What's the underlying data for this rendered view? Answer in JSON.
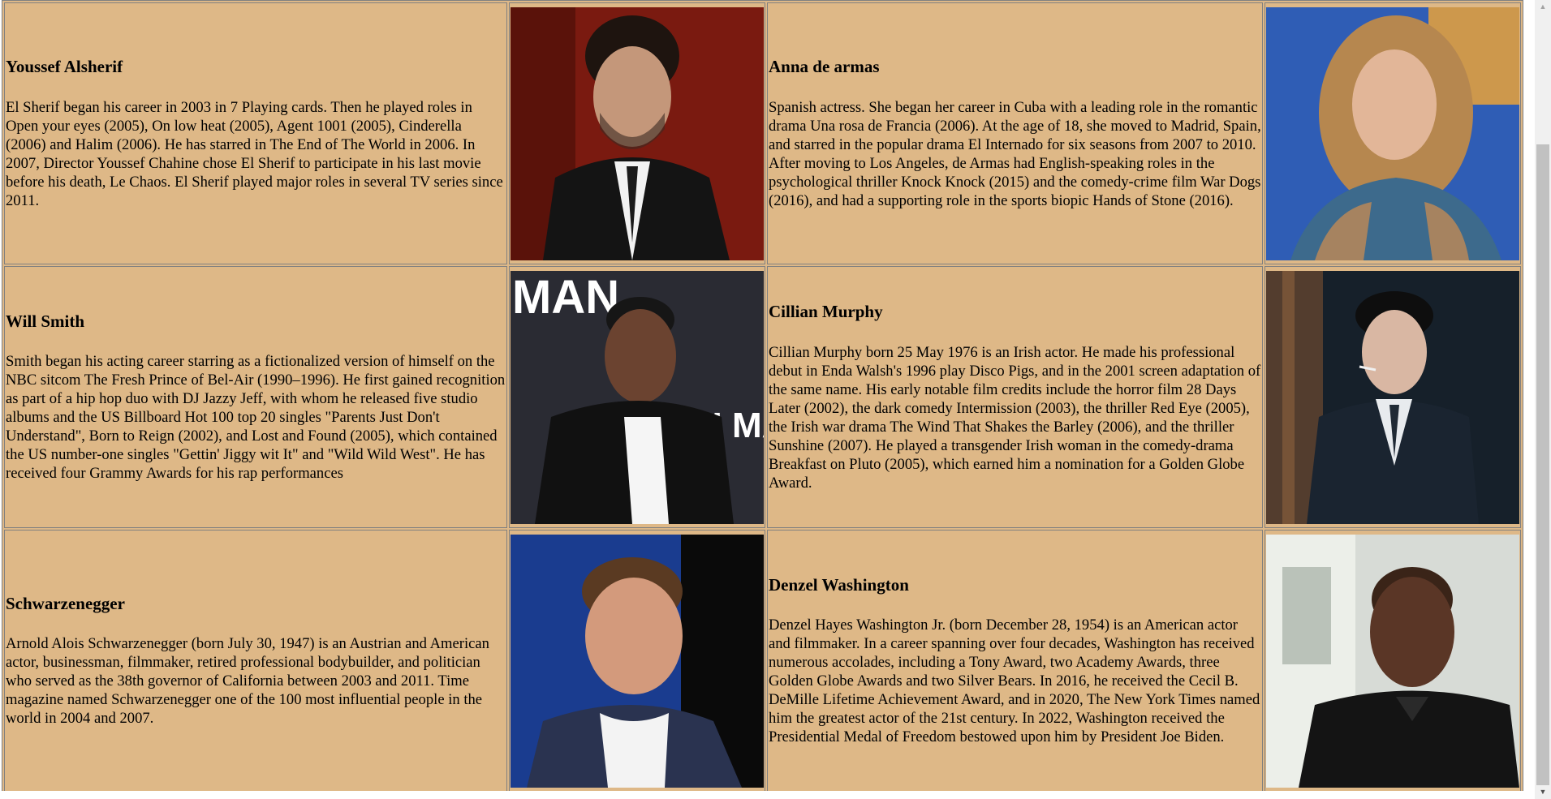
{
  "actors": [
    {
      "name": "Youssef Alsherif",
      "bio": "El Sherif began his career in 2003 in 7 Playing cards. Then he played roles in Open your eyes (2005), On low heat (2005), Agent 1001 (2005), Cinderella (2006) and Halim (2006). He has starred in The End of The World in 2006. In 2007, Director Youssef Chahine chose El Sherif to participate in his last movie before his death, Le Chaos. El Sherif played major roles in several TV series since 2011.",
      "photo_palette": {
        "bg": "#8a1c10",
        "skin": "#c79a7c",
        "suit": "#151515",
        "hair": "#201510"
      }
    },
    {
      "name": "Anna de armas",
      "bio": "Spanish actress. She began her career in Cuba with a leading role in the romantic drama Una rosa de Francia (2006). At the age of 18, she moved to Madrid, Spain, and starred in the popular drama El Internado for six seasons from 2007 to 2010. After moving to Los Angeles, de Armas had English-speaking roles in the psychological thriller Knock Knock (2015) and the comedy-crime film War Dogs (2016), and had a supporting role in the sports biopic Hands of Stone (2016).",
      "photo_palette": {
        "bg": "#2f5db5",
        "skin": "#e0b396",
        "suit": "#3c6a8a",
        "hair": "#b88a52"
      }
    },
    {
      "name": "Will Smith",
      "bio": "Smith began his acting career starring as a fictionalized version of himself on the NBC sitcom The Fresh Prince of Bel-Air (1990–1996). He first gained recognition as part of a hip hop duo with DJ Jazzy Jeff, with whom he released five studio albums and the US Billboard Hot 100 top 20 singles \"Parents Just Don't Understand\", Born to Reign (2002), and Lost and Found (2005), which contained the US number-one singles \"Gettin' Jiggy wit It\" and \"Wild Wild West\". He has received four Grammy Awards for his rap performances",
      "photo_palette": {
        "bg": "#2a2b33",
        "skin": "#6b4330",
        "suit": "#111111",
        "hair": "#1a1a1a"
      },
      "backdrop_text": [
        "MAN",
        "ANI MAN"
      ]
    },
    {
      "name": "Cillian Murphy",
      "bio": "Cillian Murphy born 25 May 1976 is an Irish actor. He made his professional debut in Enda Walsh's 1996 play Disco Pigs, and in the 2001 screen adaptation of the same name. His early notable film credits include the horror film 28 Days Later (2002), the dark comedy Intermission (2003), the thriller Red Eye (2005), the Irish war drama The Wind That Shakes the Barley (2006), and the thriller Sunshine (2007). He played a transgender Irish woman in the comedy-drama Breakfast on Pluto (2005), which earned him a nomination for a Golden Globe Award.",
      "photo_palette": {
        "bg": "#1b2630",
        "skin": "#d9b7a3",
        "suit": "#17202a",
        "hair": "#0e0e0e"
      }
    },
    {
      "name": "Schwarzenegger",
      "bio": "Arnold Alois Schwarzenegger (born July 30, 1947) is an Austrian and American actor, businessman, filmmaker, retired professional bodybuilder, and politician who served as the 38th governor of California between 2003 and 2011. Time magazine named Schwarzenegger one of the 100 most influential people in the world in 2004 and 2007.",
      "photo_palette": {
        "bg": "#1a3c8f",
        "skin": "#d39a7c",
        "suit": "#2a3350",
        "hair": "#5a3a22"
      }
    },
    {
      "name": "Denzel Washington",
      "bio": "Denzel Hayes Washington Jr. (born December 28, 1954) is an American actor and filmmaker. In a career spanning over four decades, Washington has received numerous accolades, including a Tony Award, two Academy Awards, three Golden Globe Awards and two Silver Bears. In 2016, he received the Cecil B. DeMille Lifetime Achievement Award, and in 2020, The New York Times named him the greatest actor of the 21st century. In 2022, Washington received the Presidential Medal of Freedom bestowed upon him by President Joe Biden.",
      "photo_palette": {
        "bg": "#d7dbd6",
        "skin": "#5a3626",
        "suit": "#141414",
        "hair": "#2a2a2a"
      }
    }
  ],
  "theme": {
    "cell_bg": "#deb887",
    "border": "#808080"
  },
  "scrollbar": {
    "up_icon": "scroll-up-arrow-icon",
    "down_icon": "scroll-down-arrow-icon"
  }
}
